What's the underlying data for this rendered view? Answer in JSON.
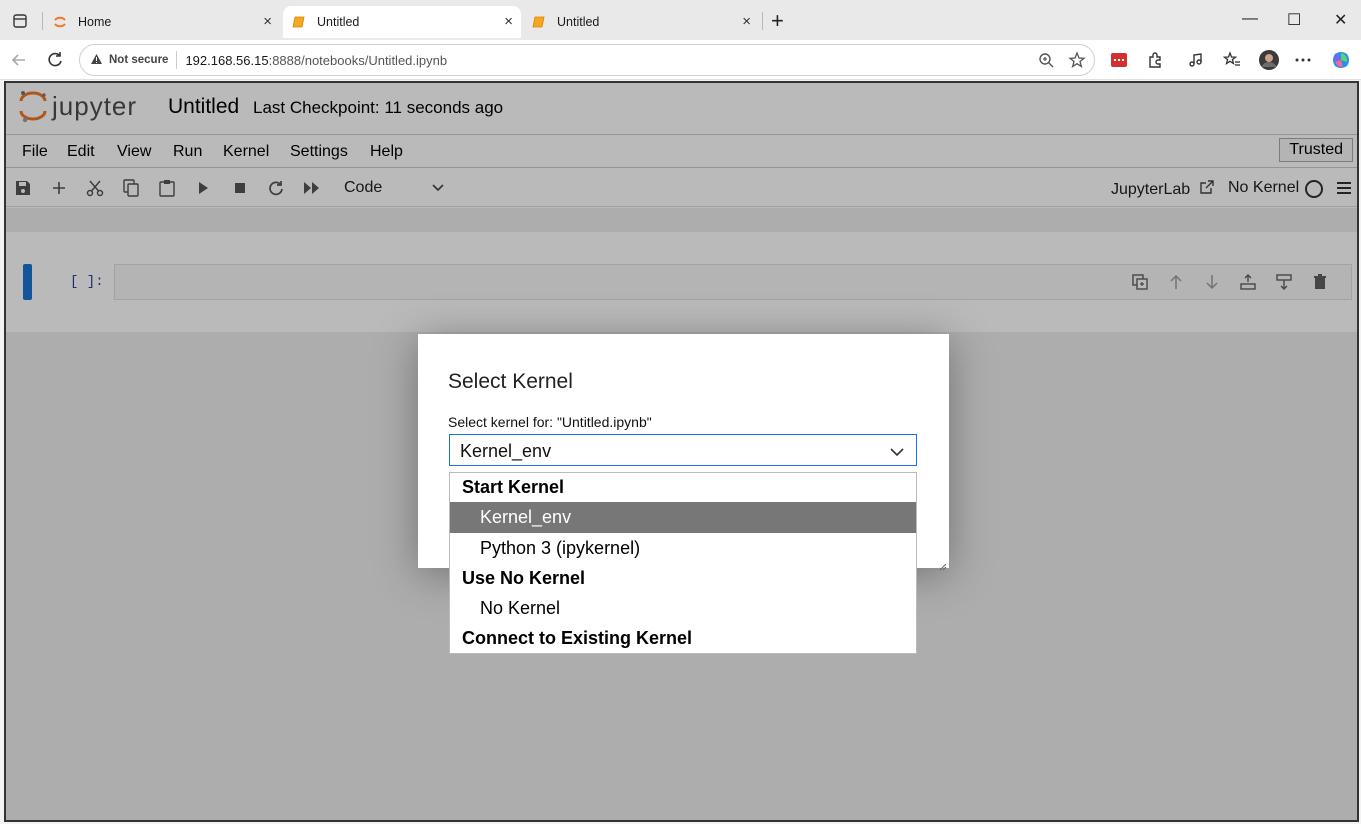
{
  "browser": {
    "tabs": [
      {
        "title": "Home",
        "close": "×"
      },
      {
        "title": "Untitled",
        "close": "×"
      },
      {
        "title": "Untitled",
        "close": "×"
      }
    ],
    "new_tab": "+",
    "window_controls": {
      "minimize": "—",
      "maximize": "☐",
      "close": "✕"
    },
    "security_label": "Not secure",
    "url_host": "192.168.56.15",
    "url_path": ":8888/notebooks/Untitled.ipynb"
  },
  "jupyter": {
    "logo_text": "jupyter",
    "notebook_title": "Untitled",
    "checkpoint": "Last Checkpoint: 11 seconds ago",
    "menu": [
      "File",
      "Edit",
      "View",
      "Run",
      "Kernel",
      "Settings",
      "Help"
    ],
    "trusted_label": "Trusted",
    "toolbar": {
      "cell_type": "Code",
      "jupyterlab_label": "JupyterLab",
      "kernel_status": "No Kernel"
    },
    "cell": {
      "prompt": "[ ]:"
    }
  },
  "dialog": {
    "title": "Select Kernel",
    "label": "Select kernel for: \"Untitled.ipynb\"",
    "selected": "Kernel_env",
    "options": {
      "group_start": "Start Kernel",
      "kernel_env": "Kernel_env",
      "python3": "Python 3 (ipykernel)",
      "group_none": "Use No Kernel",
      "no_kernel": "No Kernel",
      "group_connect": "Connect to Existing Kernel"
    }
  },
  "colors": {
    "jupyter_orange": "#f37726",
    "cell_active_bar": "#1976d2",
    "option_selected_bg": "#777777",
    "select_border": "#1a73e8"
  }
}
